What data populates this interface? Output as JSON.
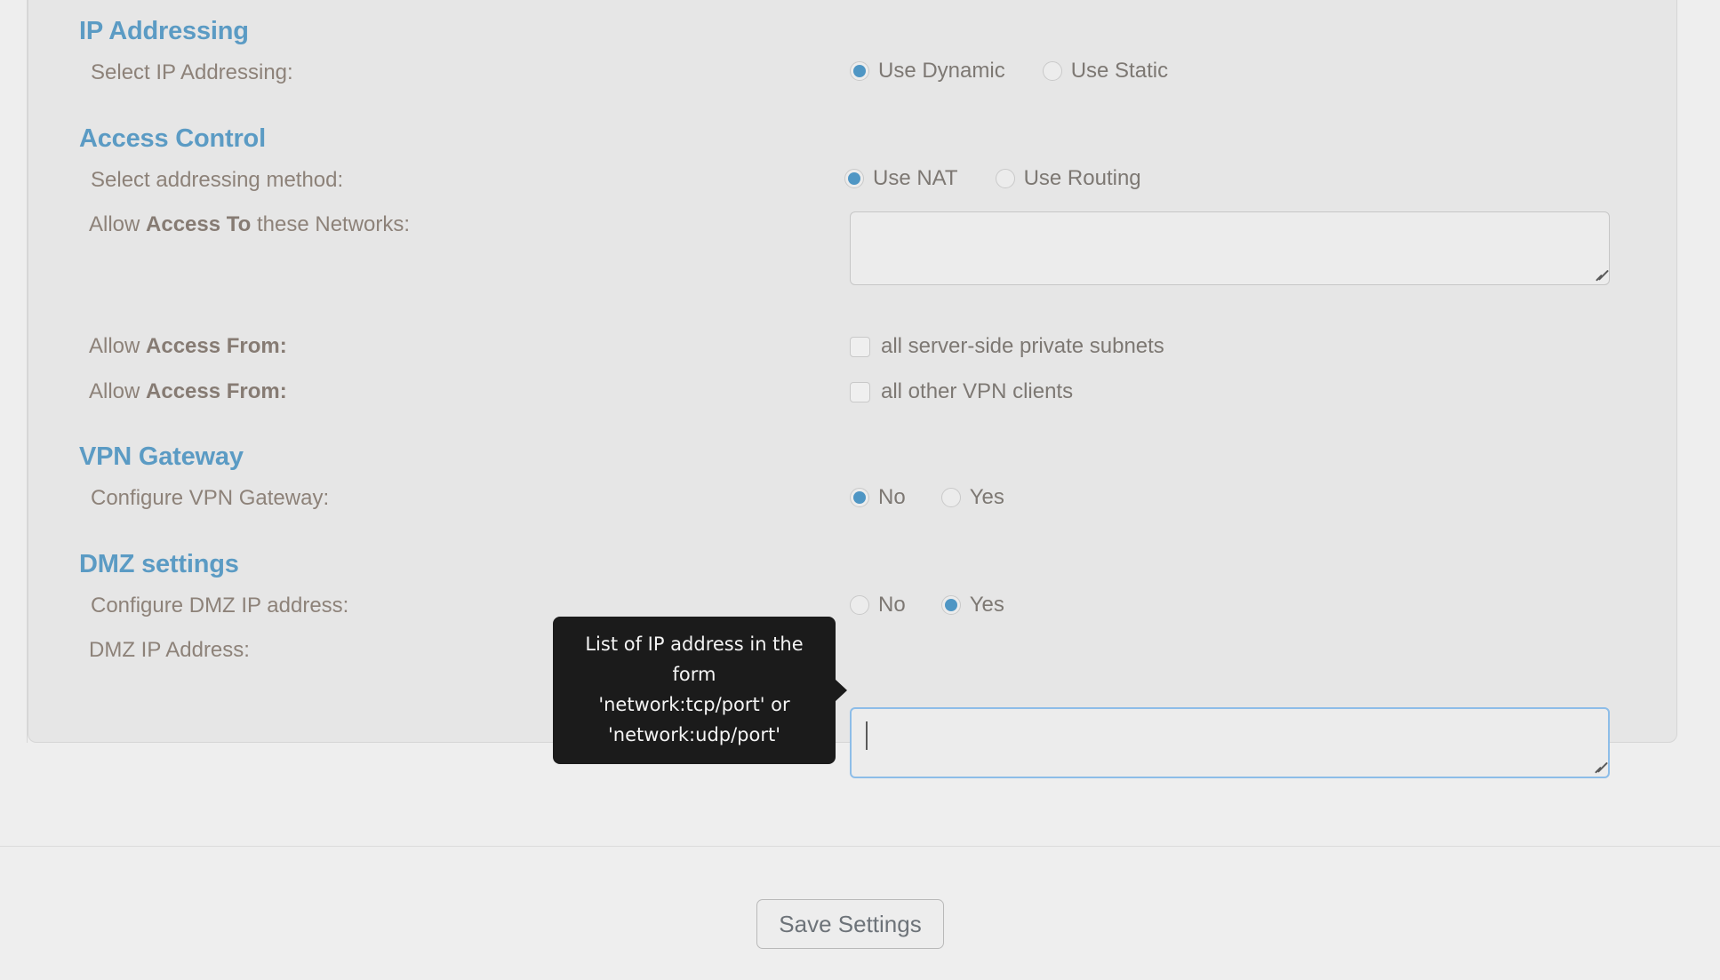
{
  "sections": [
    {
      "id": "ip-addressing",
      "title": "IP Addressing",
      "rows": [
        {
          "id": "select-ip-addressing",
          "label_prefix": "Select IP Addressing:",
          "label_bold": "",
          "label_suffix": "",
          "control": "radio",
          "options": [
            {
              "label": "Use Dynamic",
              "selected": true
            },
            {
              "label": "Use Static",
              "selected": false
            }
          ]
        }
      ]
    },
    {
      "id": "access-control",
      "title": "Access Control",
      "rows": [
        {
          "id": "select-addressing-method",
          "label_prefix": "Select addressing method:",
          "label_bold": "",
          "label_suffix": "",
          "control": "radio",
          "options": [
            {
              "label": "Use NAT",
              "selected": true
            },
            {
              "label": "Use Routing",
              "selected": false
            }
          ]
        },
        {
          "id": "allow-access-to-networks",
          "label_prefix": "Allow ",
          "label_bold": "Access To",
          "label_suffix": " these Networks:",
          "control": "textarea",
          "value": "",
          "focused": false
        },
        {
          "id": "allow-access-from-subnets",
          "label_prefix": "Allow ",
          "label_bold": "Access From:",
          "label_suffix": "",
          "control": "checkbox",
          "checkbox_label": "all server-side private subnets",
          "checked": false
        },
        {
          "id": "allow-access-from-vpn-clients",
          "label_prefix": "Allow ",
          "label_bold": "Access From:",
          "label_suffix": "",
          "control": "checkbox",
          "checkbox_label": "all other VPN clients",
          "checked": false
        }
      ]
    },
    {
      "id": "vpn-gateway",
      "title": "VPN Gateway",
      "rows": [
        {
          "id": "configure-vpn-gateway",
          "label_prefix": "Configure VPN Gateway:",
          "label_bold": "",
          "label_suffix": "",
          "control": "radio",
          "options": [
            {
              "label": "No",
              "selected": true
            },
            {
              "label": "Yes",
              "selected": false
            }
          ]
        }
      ]
    },
    {
      "id": "dmz-settings",
      "title": "DMZ settings",
      "rows": [
        {
          "id": "configure-dmz-ip-address",
          "label_prefix": "Configure DMZ IP address:",
          "label_bold": "",
          "label_suffix": "",
          "control": "radio",
          "options": [
            {
              "label": "No",
              "selected": false
            },
            {
              "label": "Yes",
              "selected": true
            }
          ]
        },
        {
          "id": "dmz-ip-address",
          "label_prefix": "DMZ IP Address:",
          "label_bold": "",
          "label_suffix": "",
          "control": "textarea",
          "value": "",
          "focused": true
        }
      ]
    }
  ],
  "tooltip": {
    "lines": [
      "List of IP address in the form",
      "'network:tcp/port' or",
      "'network:udp/port'"
    ],
    "background": "#1b1b1b",
    "text_color": "#f4f4f4"
  },
  "footer": {
    "save_label": "Save Settings"
  },
  "theme": {
    "accent": "#5b9bc4",
    "radio_fill": "#4f96c4",
    "label_color": "#8d8279",
    "panel_bg": "#e6e6e6",
    "page_bg": "#eeeeee",
    "focus_border": "#8dbde8"
  }
}
